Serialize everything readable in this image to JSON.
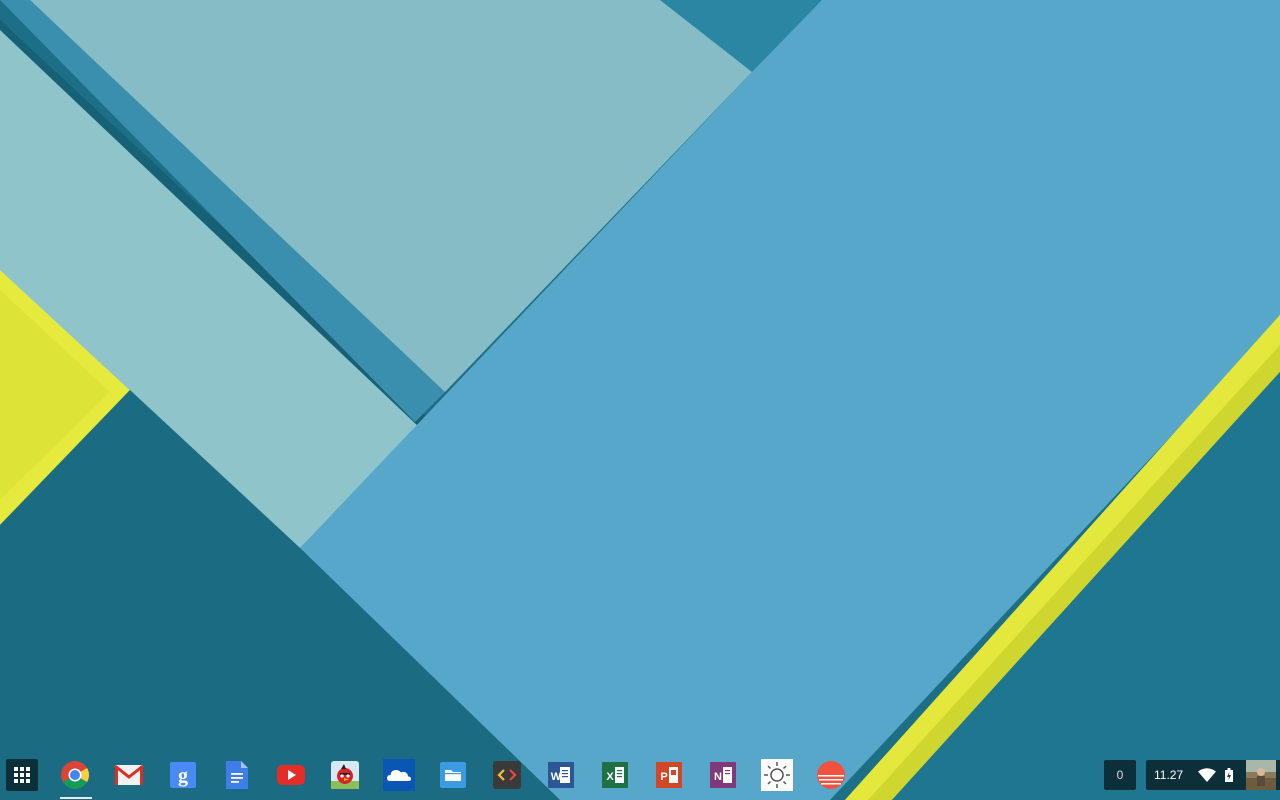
{
  "shelf": {
    "launcher_icon": "app-launcher-grid-icon",
    "apps": [
      {
        "id": "chrome",
        "icon": "chrome-icon",
        "active": true
      },
      {
        "id": "gmail",
        "icon": "gmail-icon",
        "active": false
      },
      {
        "id": "google-search",
        "icon": "google-search-icon",
        "active": false
      },
      {
        "id": "docs",
        "icon": "google-docs-icon",
        "active": false
      },
      {
        "id": "youtube",
        "icon": "youtube-icon",
        "active": false
      },
      {
        "id": "angry-birds",
        "icon": "angry-birds-icon",
        "active": false
      },
      {
        "id": "onedrive",
        "icon": "onedrive-icon",
        "active": false
      },
      {
        "id": "files",
        "icon": "files-icon",
        "active": false
      },
      {
        "id": "code-editor",
        "icon": "code-editor-icon",
        "active": false
      },
      {
        "id": "word",
        "icon": "word-icon",
        "active": false
      },
      {
        "id": "excel",
        "icon": "excel-icon",
        "active": false
      },
      {
        "id": "powerpoint",
        "icon": "powerpoint-icon",
        "active": false
      },
      {
        "id": "onenote",
        "icon": "onenote-icon",
        "active": false
      },
      {
        "id": "weather",
        "icon": "sun-icon",
        "active": false
      },
      {
        "id": "sunrise",
        "icon": "sunrise-icon",
        "active": false
      }
    ]
  },
  "tray": {
    "notification_count": "0",
    "clock": "11.27",
    "wifi_icon": "wifi-icon",
    "battery_icon": "battery-icon",
    "avatar_icon": "user-avatar"
  },
  "colors": {
    "wallpaper_dark_teal": "#1b6f85",
    "wallpaper_light_teal": "#86bcc4",
    "wallpaper_blue": "#54a6c8",
    "wallpaper_stripe": "#3b8eac",
    "wallpaper_yellow": "#e2e63a"
  }
}
